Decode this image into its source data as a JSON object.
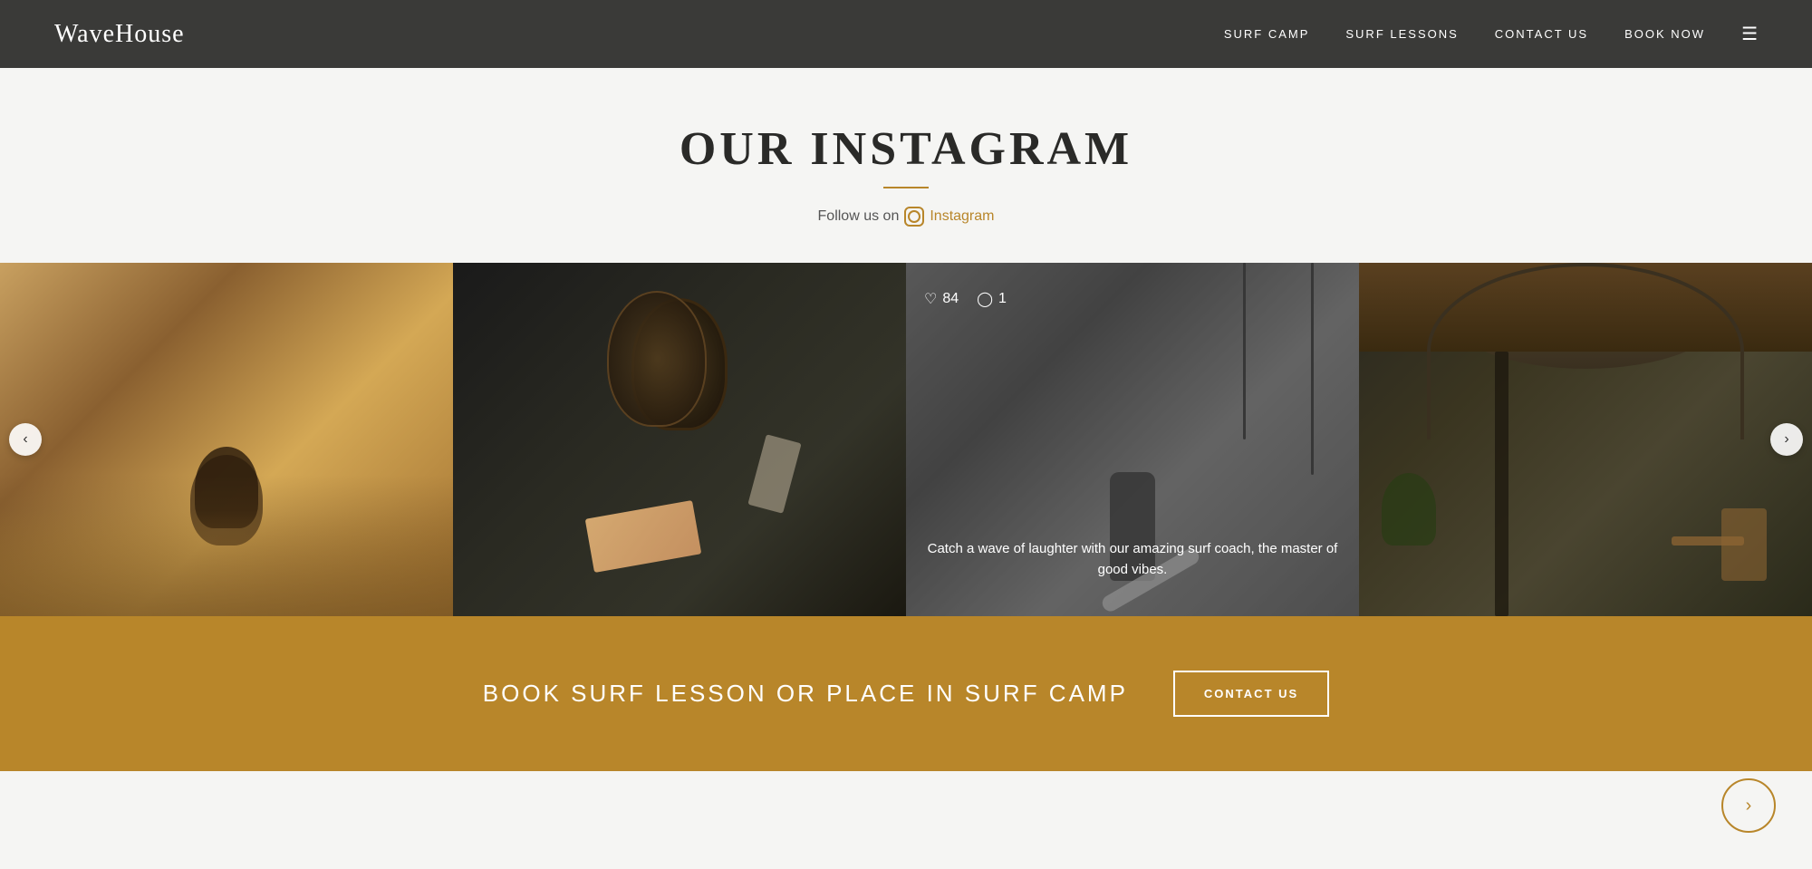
{
  "nav": {
    "logo": "WaveHouse",
    "links": [
      {
        "id": "surf-camp",
        "label": "SURF CAMP"
      },
      {
        "id": "surf-lessons",
        "label": "SURF LESSONS"
      },
      {
        "id": "contact-us",
        "label": "CONTACT US"
      },
      {
        "id": "book-now",
        "label": "BOOK NOW"
      }
    ]
  },
  "instagram": {
    "title": "OUR INSTAGRAM",
    "follow_text": "Follow us on",
    "follow_link": "Instagram",
    "photos": [
      {
        "id": "photo-1",
        "alt": "Surfer in water",
        "type": "ocean"
      },
      {
        "id": "photo-2",
        "alt": "Food and table setting",
        "type": "food"
      },
      {
        "id": "photo-3",
        "alt": "Surf coach with board",
        "type": "surf-coach",
        "likes": 84,
        "comments": 1,
        "caption": "Catch a wave of laughter with our amazing surf coach, the master of good vibes."
      },
      {
        "id": "photo-4",
        "alt": "Interior restaurant/lounge",
        "type": "interior"
      }
    ]
  },
  "carousel": {
    "prev_label": "‹",
    "next_label": "›"
  },
  "cta": {
    "text": "BOOK SURF LESSON OR PLACE IN SURF CAMP",
    "button_label": "CONTACT US"
  },
  "bottom_nav": {
    "arrow": "›"
  }
}
